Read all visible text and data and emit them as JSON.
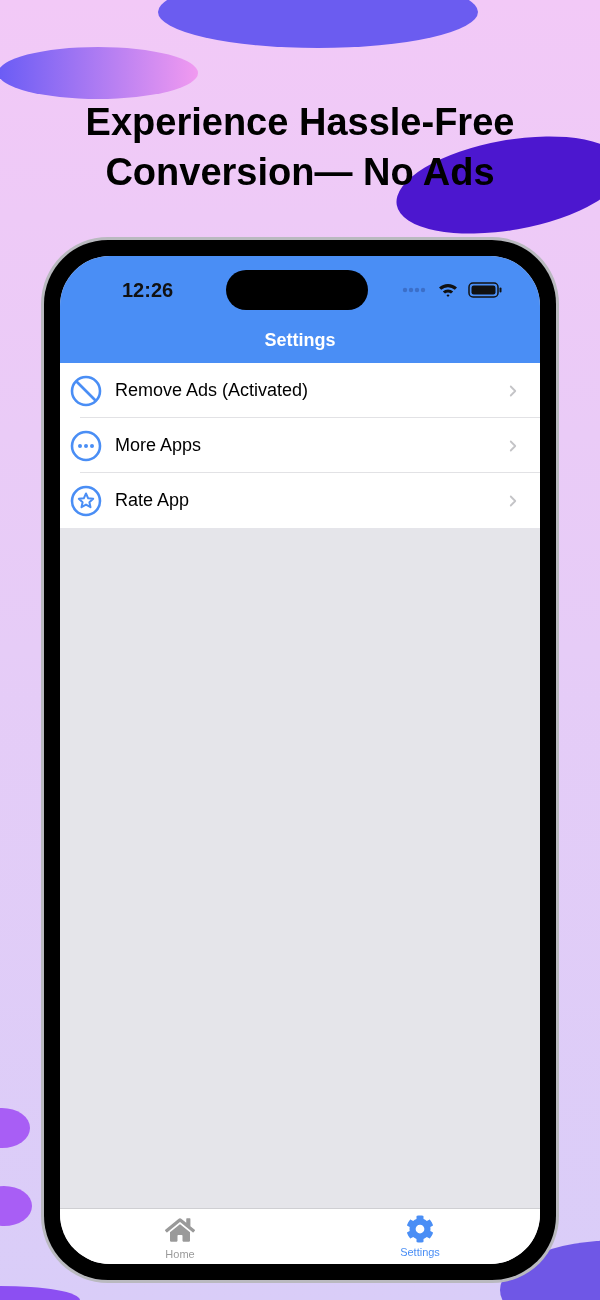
{
  "headline": "Experience Hassle-Free Conversion— No Ads",
  "status_bar": {
    "time": "12:26"
  },
  "nav_title": "Settings",
  "items": [
    {
      "kind": "block",
      "label": "Remove Ads (Activated)"
    },
    {
      "kind": "more",
      "label": "More Apps"
    },
    {
      "kind": "star",
      "label": "Rate App"
    }
  ],
  "tabs": [
    {
      "kind": "home",
      "label": "Home",
      "selected": false
    },
    {
      "kind": "gear",
      "label": "Settings",
      "selected": true
    }
  ]
}
